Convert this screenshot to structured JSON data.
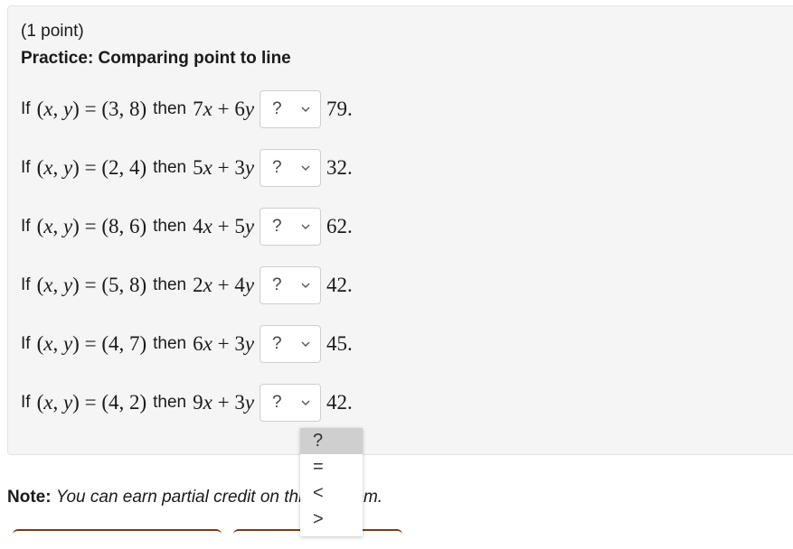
{
  "problem": {
    "points": "(1 point)",
    "title": "Practice: Comparing point to line",
    "rows": [
      {
        "if": "If",
        "point": "(3, 8)",
        "then": "then",
        "a": "7",
        "b": "6",
        "select": "?",
        "rhs": "79"
      },
      {
        "if": "If",
        "point": "(2, 4)",
        "then": "then",
        "a": "5",
        "b": "3",
        "select": "?",
        "rhs": "32"
      },
      {
        "if": "If",
        "point": "(8, 6)",
        "then": "then",
        "a": "4",
        "b": "5",
        "select": "?",
        "rhs": "62"
      },
      {
        "if": "If",
        "point": "(5, 8)",
        "then": "then",
        "a": "2",
        "b": "4",
        "select": "?",
        "rhs": "42"
      },
      {
        "if": "If",
        "point": "(4, 7)",
        "then": "then",
        "a": "6",
        "b": "3",
        "select": "?",
        "rhs": "45"
      },
      {
        "if": "If",
        "point": "(4, 2)",
        "then": "then",
        "a": "9",
        "b": "3",
        "select": "?",
        "rhs": "42"
      }
    ]
  },
  "dropdown": {
    "open_for_row": 6,
    "options": [
      "?",
      "=",
      "<",
      ">"
    ],
    "highlighted": "?"
  },
  "note": {
    "label": "Note:",
    "text": "You can earn partial credit on this problem."
  },
  "colors": {
    "panel_bg": "#f5f5f5",
    "button_border": "#7a3a12",
    "option_highlight": "#cfcfcf"
  }
}
